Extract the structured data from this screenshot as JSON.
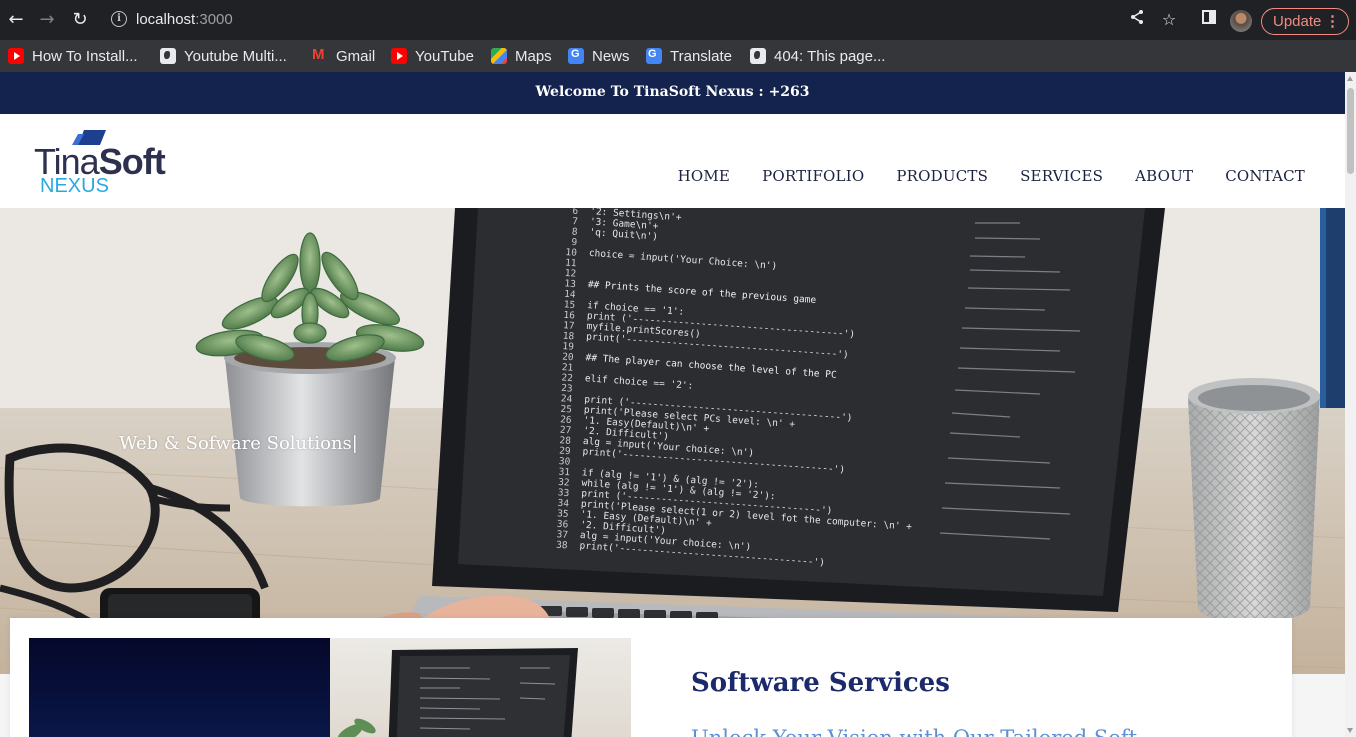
{
  "browser": {
    "url_host": "localhost",
    "url_port": ":3000",
    "update_label": "Update",
    "icons": [
      "back-icon",
      "forward-icon",
      "reload-icon",
      "info-icon",
      "share-icon",
      "star-icon",
      "side-panel-icon",
      "more-icon"
    ]
  },
  "bookmarks": [
    {
      "label": "How To Install...",
      "icon": "youtube-icon"
    },
    {
      "label": "Youtube Multi...",
      "icon": "globe-icon"
    },
    {
      "label": "Gmail",
      "icon": "gmail-icon"
    },
    {
      "label": "YouTube",
      "icon": "youtube-icon"
    },
    {
      "label": "Maps",
      "icon": "maps-icon"
    },
    {
      "label": "News",
      "icon": "news-icon"
    },
    {
      "label": "Translate",
      "icon": "translate-icon"
    },
    {
      "label": "404: This page...",
      "icon": "globe-icon"
    }
  ],
  "site": {
    "welcome": "Welcome To TinaSoft Nexus : +263",
    "logo": {
      "part1": "Tina",
      "part2": "Soft",
      "part3": "NEXUS"
    },
    "nav": [
      "HOME",
      "PORTIFOLIO",
      "PRODUCTS",
      "SERVICES",
      "ABOUT",
      "CONTACT"
    ],
    "hero_tagline": "Web & Sofware Solutions",
    "hero_caret": "|",
    "section": {
      "title": "Software Services",
      "subtitle": "Unlock Your Vision with Our Tailored Soft"
    },
    "colors": {
      "top_bar": "#14224e",
      "nav_text": "#1d2240",
      "section_title": "#1c2a6b",
      "section_subtitle": "#5b8ed6",
      "logo_accent": "#29a9e1"
    }
  },
  "code_lines": [
    {
      "n": "6",
      "t": "'2: Settings\\n'+"
    },
    {
      "n": "7",
      "t": "'3: Game\\n'+"
    },
    {
      "n": "8",
      "t": "'q: Quit\\n')"
    },
    {
      "n": "9",
      "t": ""
    },
    {
      "n": "10",
      "t": "choice = input('Your Choice: \\n')"
    },
    {
      "n": "11",
      "t": ""
    },
    {
      "n": "12",
      "t": ""
    },
    {
      "n": "13",
      "t": "##  Prints the score of the previous game"
    },
    {
      "n": "14",
      "t": ""
    },
    {
      "n": "15",
      "t": "if choice == '1':"
    },
    {
      "n": "16",
      "t": "   print ('-------------------------------------')"
    },
    {
      "n": "17",
      "t": "   myfile.printScores()"
    },
    {
      "n": "18",
      "t": "   print('-------------------------------------')"
    },
    {
      "n": "19",
      "t": ""
    },
    {
      "n": "20",
      "t": "##  The player can choose the level of the PC"
    },
    {
      "n": "21",
      "t": ""
    },
    {
      "n": "22",
      "t": "elif choice == '2':"
    },
    {
      "n": "23",
      "t": ""
    },
    {
      "n": "24",
      "t": "   print ('-------------------------------------')"
    },
    {
      "n": "25",
      "t": "   print('Please select PCs level: \\n' +"
    },
    {
      "n": "26",
      "t": "      '1. Easy(Default)\\n' +"
    },
    {
      "n": "27",
      "t": "      '2. Difficult')"
    },
    {
      "n": "28",
      "t": "   alg = input('Your choice: \\n')"
    },
    {
      "n": "29",
      "t": "   print('-------------------------------------')"
    },
    {
      "n": "30",
      "t": ""
    },
    {
      "n": "31",
      "t": "if (alg != '1') & (alg != '2'):"
    },
    {
      "n": "32",
      "t": "   while (alg != '1') & (alg != '2'):"
    },
    {
      "n": "33",
      "t": "      print ('----------------------------------')"
    },
    {
      "n": "34",
      "t": "      print('Please select(1 or 2) level fot the computer: \\n' +"
    },
    {
      "n": "35",
      "t": "         '1. Easy (Default)\\n' +"
    },
    {
      "n": "36",
      "t": "         '2. Difficult')"
    },
    {
      "n": "37",
      "t": "      alg = input('Your choice: \\n')"
    },
    {
      "n": "38",
      "t": "      print('----------------------------------')"
    }
  ]
}
